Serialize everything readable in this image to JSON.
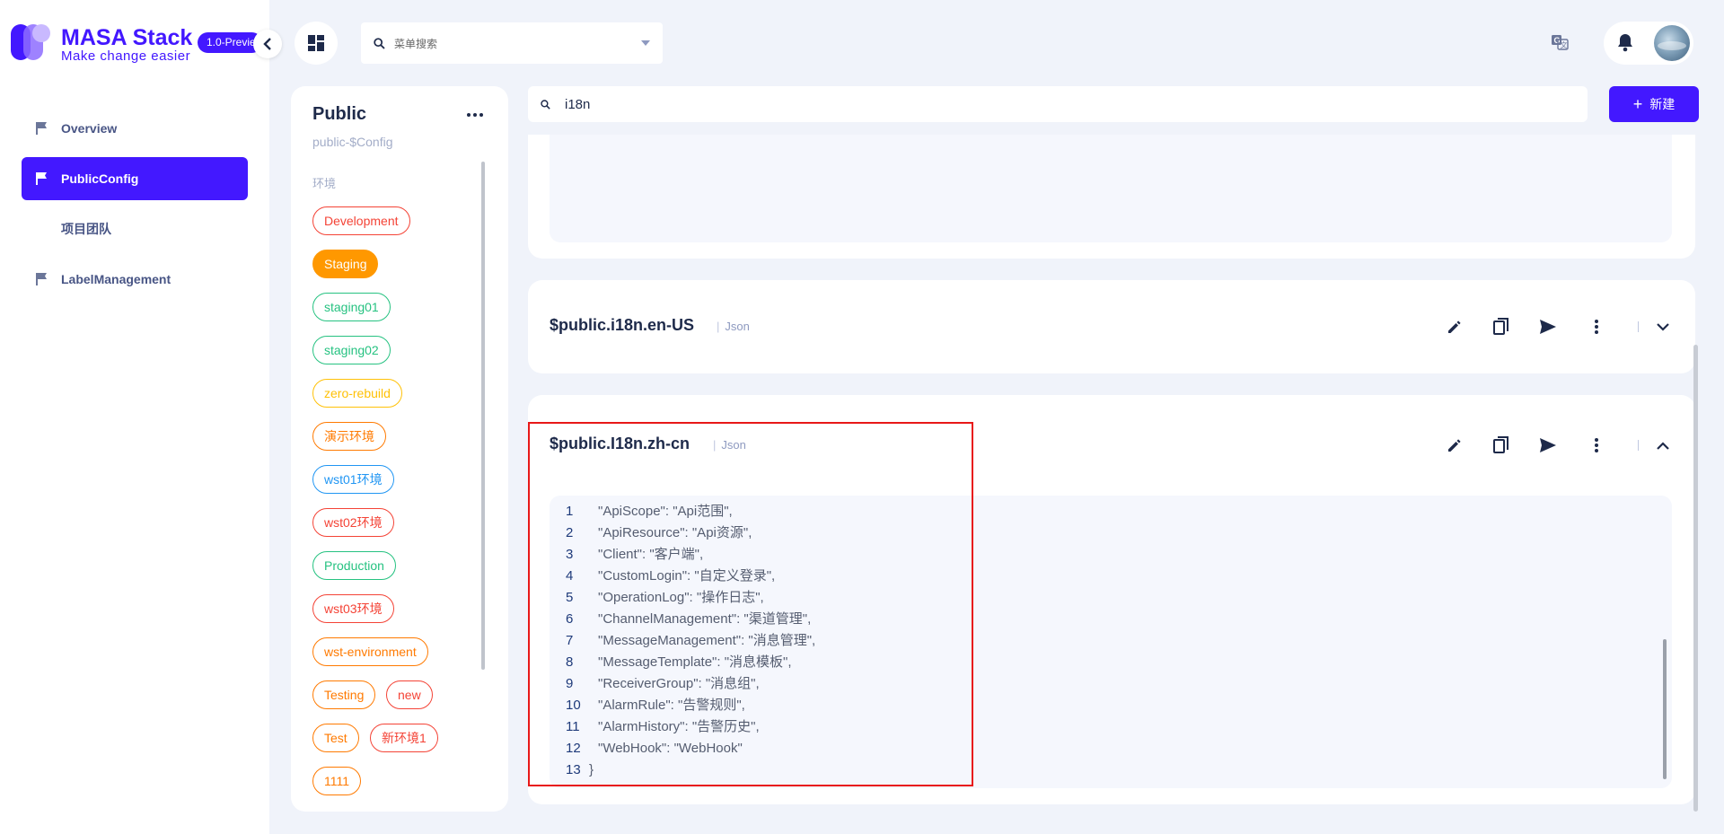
{
  "brand": {
    "title": "MASA Stack",
    "subtitle": "Make change easier",
    "version": "1.0-Preview"
  },
  "nav": {
    "items": [
      {
        "label": "Overview",
        "icon": "flag-icon"
      },
      {
        "label": "PublicConfig",
        "icon": "flag-icon",
        "active": true
      },
      {
        "label": "项目团队"
      },
      {
        "label": "LabelManagement",
        "icon": "flag-icon"
      }
    ]
  },
  "topbar": {
    "menu_search_placeholder": "菜单搜索"
  },
  "config_panel": {
    "title": "Public",
    "subtitle": "public-$Config",
    "env_label": "环境",
    "environments": [
      {
        "label": "Development",
        "color": "#f44336"
      },
      {
        "label": "Staging",
        "color": "#ff9800",
        "selected": true
      },
      {
        "label": "staging01",
        "color": "#26c281"
      },
      {
        "label": "staging02",
        "color": "#26c281"
      },
      {
        "label": "zero-rebuild",
        "color": "#ffc107"
      },
      {
        "label": "演示环境",
        "color": "#ff7a00"
      },
      {
        "label": "wst01环境",
        "color": "#2196f3"
      },
      {
        "label": "wst02环境",
        "color": "#f44336"
      },
      {
        "label": "Production",
        "color": "#26c281"
      },
      {
        "label": "wst03环境",
        "color": "#f44336"
      },
      {
        "label": "wst-environment",
        "color": "#ff7a00"
      },
      {
        "label": "Testing",
        "color": "#ff7a00"
      },
      {
        "label": "new",
        "color": "#f44336"
      },
      {
        "label": "Test",
        "color": "#ff7a00"
      },
      {
        "label": "新环境1",
        "color": "#f44336"
      },
      {
        "label": "1111",
        "color": "#ff7a00"
      }
    ]
  },
  "main": {
    "search_value": "i18n",
    "new_button": "新建",
    "configs": [
      {
        "name": "$public.i18n.en-US",
        "type": "Json"
      },
      {
        "name": "$public.I18n.zh-cn",
        "type": "Json"
      }
    ],
    "code_lines": [
      {
        "n": "1",
        "text": "\"ApiScope\": \"Api范围\","
      },
      {
        "n": "2",
        "text": "\"ApiResource\": \"Api资源\","
      },
      {
        "n": "3",
        "text": "\"Client\": \"客户端\","
      },
      {
        "n": "4",
        "text": "\"CustomLogin\": \"自定义登录\","
      },
      {
        "n": "5",
        "text": "\"OperationLog\": \"操作日志\","
      },
      {
        "n": "6",
        "text": "\"ChannelManagement\": \"渠道管理\","
      },
      {
        "n": "7",
        "text": "\"MessageManagement\": \"消息管理\","
      },
      {
        "n": "8",
        "text": "\"MessageTemplate\": \"消息模板\","
      },
      {
        "n": "9",
        "text": "\"ReceiverGroup\": \"消息组\","
      },
      {
        "n": "10",
        "text": "\"AlarmRule\": \"告警规则\","
      },
      {
        "n": "11",
        "text": "\"AlarmHistory\": \"告警历史\","
      },
      {
        "n": "12",
        "text": "\"WebHook\": \"WebHook\""
      },
      {
        "n": "13",
        "text": "}"
      }
    ]
  },
  "colors": {
    "accent": "#4318ff",
    "highlight": "#e81818"
  }
}
